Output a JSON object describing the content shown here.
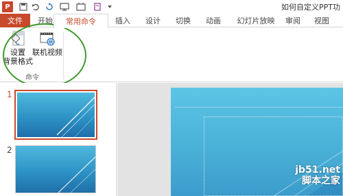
{
  "titlebar": {
    "app_icon_label": "P",
    "doc_title": "如何自定义PPT功",
    "qat_icons": [
      "save-icon",
      "undo-icon",
      "redo-icon",
      "present-icon",
      "touch-mode-icon",
      "print-preview-icon",
      "dropdown-icon"
    ]
  },
  "tabs": [
    {
      "label": "文件"
    },
    {
      "label": "开始"
    },
    {
      "label": "常用命令"
    },
    {
      "label": "插入"
    },
    {
      "label": "设计"
    },
    {
      "label": "切换"
    },
    {
      "label": "动画"
    },
    {
      "label": "幻灯片放映"
    },
    {
      "label": "审阅"
    },
    {
      "label": "视图"
    }
  ],
  "ribbon": {
    "buttons": [
      {
        "label_line1": "设置",
        "label_line2": "背景格式",
        "icon": "format-background-icon"
      },
      {
        "label_line1": "联机视频",
        "label_line2": "",
        "icon": "online-video-icon"
      }
    ],
    "group_label": "命令"
  },
  "slides": [
    {
      "number": "1",
      "selected": true
    },
    {
      "number": "2",
      "selected": false
    }
  ],
  "watermark": {
    "line1": "jb51.net",
    "line2": "脚本之家"
  },
  "colors": {
    "accent": "#c74a2c",
    "highlight_ring": "#3e9a2d",
    "slide_blue": "#3b9ccc"
  }
}
